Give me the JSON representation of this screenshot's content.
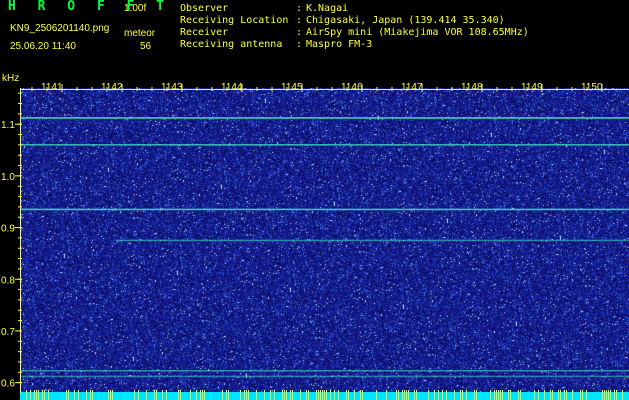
{
  "header": {
    "app_title": "H R O F F T",
    "version": "1.00f",
    "filename": "KN9_2506201140.png",
    "datetime": "25.06.20 11:40",
    "meteor_label": "meteor",
    "meteor_count": "56",
    "info": [
      {
        "label": "Observer",
        "value": "K.Nagai"
      },
      {
        "label": "Receiving Location",
        "value": "Chigasaki, Japan (139.414 35.340)"
      },
      {
        "label": "Receiver",
        "value": "AirSpy mini (Miakejima VOR 108.65MHz)"
      },
      {
        "label": "Receiving antenna",
        "value": "Maspro FM-3"
      }
    ]
  },
  "colors": {
    "background": "#000000",
    "text": "#ffff33",
    "title": "#00ff3c",
    "noise_base": "#1a1aa0",
    "signal_line": "#40e0c0",
    "bottom_bar": "#00e5ff",
    "meteor_mark": "#ffff00"
  },
  "chart_data": {
    "type": "heatmap",
    "title": "",
    "ylabel": "kHz",
    "ylim": [
      0.6,
      1.17
    ],
    "yticks": [
      0.6,
      0.7,
      0.8,
      0.9,
      1.0,
      1.1
    ],
    "ytick_labels": [
      "0.6",
      "0.7",
      "0.8",
      "0.9",
      "1.0",
      "1.1"
    ],
    "xlabel": "",
    "x_ticks": [
      1141,
      1142,
      1143,
      1144,
      1145,
      1146,
      1147,
      1148,
      1149,
      1150
    ],
    "x_tick_labels": [
      "1141",
      "1142",
      "1143",
      "1144",
      "1145",
      "1146",
      "1147",
      "1148",
      "1149",
      "1150"
    ],
    "xlim": [
      1140.3,
      1150.45
    ],
    "carrier_lines_khz": [
      {
        "freq": 1.112,
        "strength": 0.9,
        "x_start": 1140.3
      },
      {
        "freq": 1.06,
        "strength": 0.75,
        "x_start": 1140.3
      },
      {
        "freq": 0.935,
        "strength": 0.85,
        "x_start": 1140.3
      },
      {
        "freq": 0.875,
        "strength": 0.55,
        "x_start": 1141.9
      },
      {
        "freq": 0.623,
        "strength": 0.6,
        "x_start": 1140.3
      },
      {
        "freq": 0.612,
        "strength": 0.5,
        "x_start": 1140.3
      }
    ],
    "meteor_markers": true
  }
}
